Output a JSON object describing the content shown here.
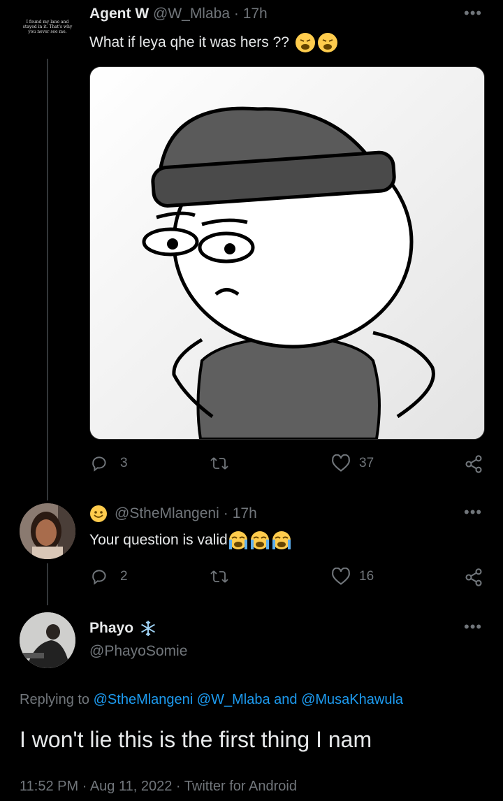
{
  "tweet1": {
    "avatar_text": "I found my lane and stayed in it. That's why you never see me.",
    "display_name": "Agent W",
    "handle": "@W_Mlaba",
    "sep": "·",
    "time": "17h",
    "text": "What if leya qhe it was hers ??",
    "emoji": "weary-face-emoji",
    "replies": "3",
    "likes": "37"
  },
  "tweet2": {
    "display_name_emoji": "smiling-face-emoji",
    "handle": "@StheMlangeni",
    "sep": "·",
    "time": "17h",
    "text": "Your question is valid",
    "emoji": "loudly-crying-face-emoji",
    "replies": "2",
    "likes": "16"
  },
  "main": {
    "display_name": "Phayo",
    "handle": "@PhayoSomie",
    "name_icon": "snowflake-icon",
    "replying_prefix": "Replying to",
    "reply_to_1": "@StheMlangeni",
    "reply_to_2": "@W_Mlaba",
    "reply_and": "and",
    "reply_to_3": "@MusaKhawula",
    "text": "I won't lie this is the first thing I nam",
    "time": "11:52 PM",
    "sep1": "·",
    "date": "Aug 11, 2022",
    "sep2": "·",
    "source": "Twitter for Android"
  },
  "colors": {
    "background": "#000000",
    "text": "#e7e9ea",
    "muted": "#71767b",
    "link": "#1d9bf0"
  }
}
